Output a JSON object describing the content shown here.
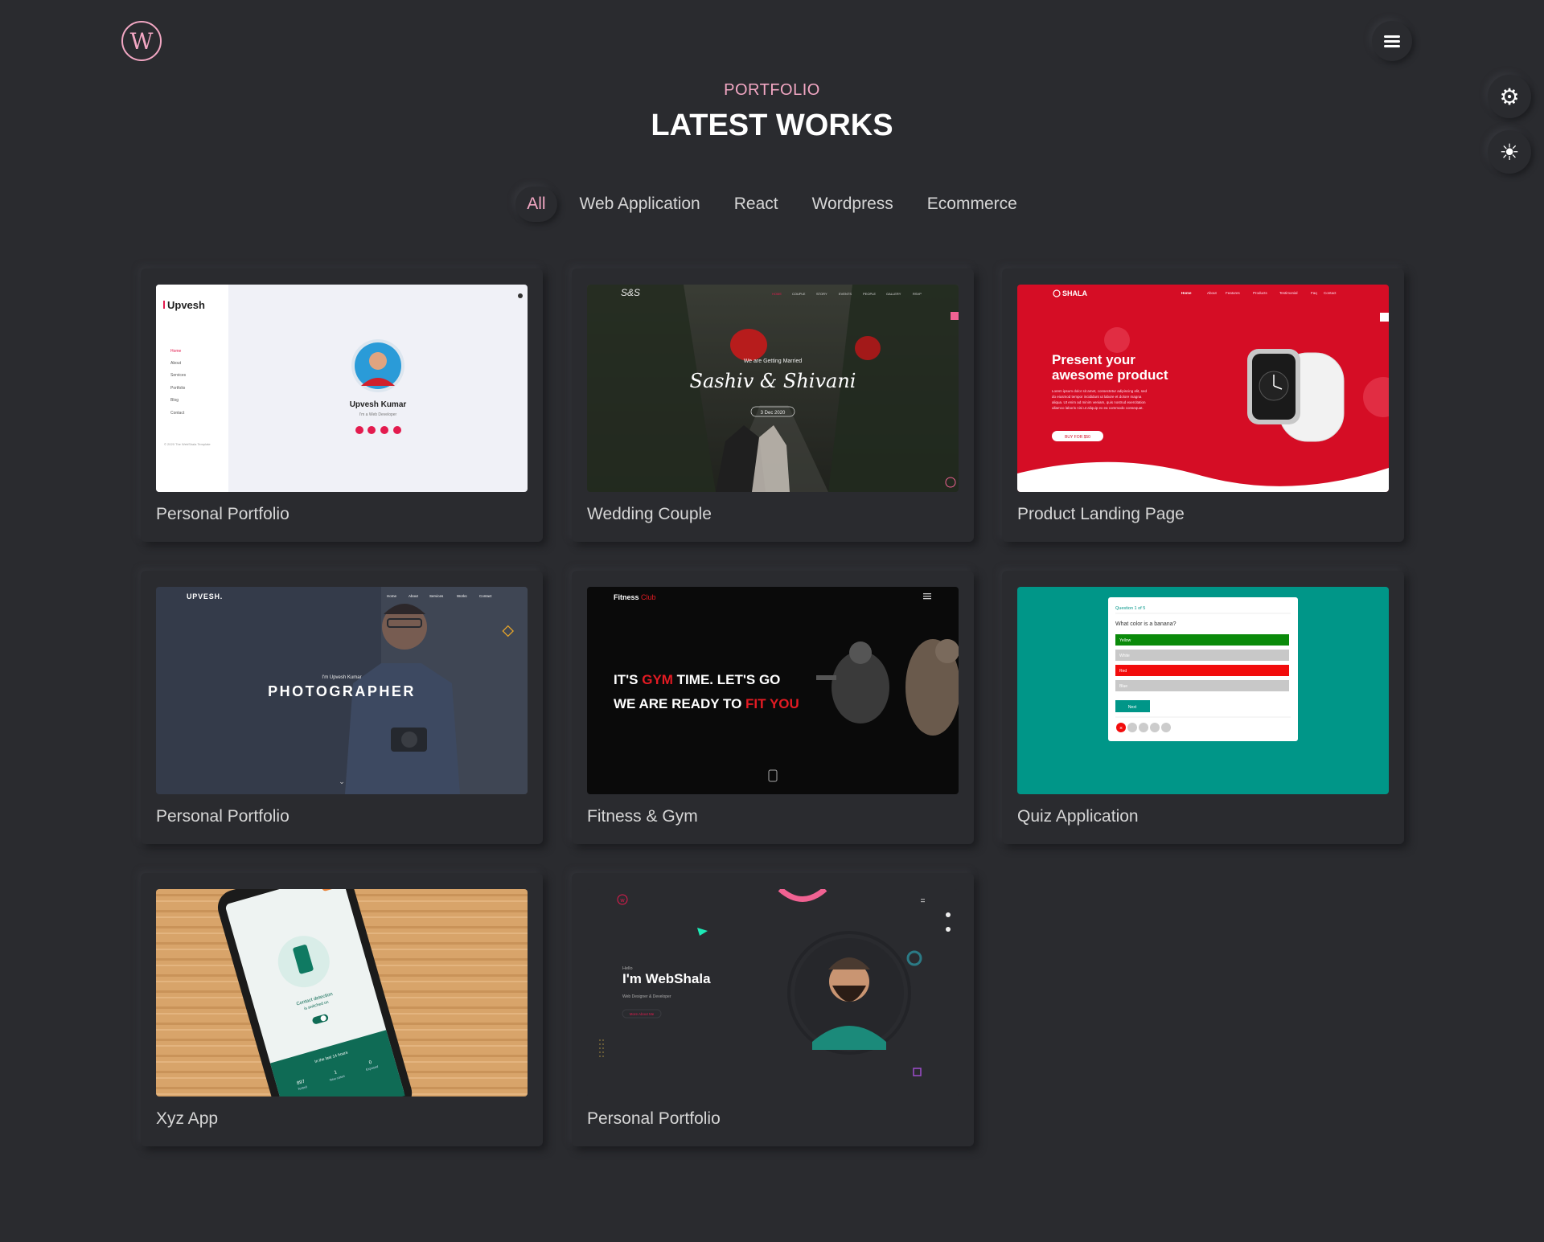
{
  "header": {
    "logo_letter": "W",
    "menu_icon": "hamburger-menu-icon"
  },
  "side_controls": {
    "settings_icon": "gear-icon",
    "theme_icon": "sun-icon"
  },
  "section": {
    "subtitle": "PORTFOLIO",
    "title": "LATEST WORKS"
  },
  "filters": [
    {
      "label": "All",
      "active": true
    },
    {
      "label": "Web Application",
      "active": false
    },
    {
      "label": "React",
      "active": false
    },
    {
      "label": "Wordpress",
      "active": false
    },
    {
      "label": "Ecommerce",
      "active": false
    }
  ],
  "colors": {
    "background": "#2a2b2f",
    "accent": "#f2a7c3",
    "text": "#d6d6d6"
  },
  "works": [
    {
      "caption": "Personal Portfolio",
      "thumb": {
        "brand": "Upvesh",
        "name": "Upvesh Kumar",
        "role": "I'm a Web Developer",
        "nav": [
          "Home",
          "About",
          "Services",
          "Portfolio",
          "Blog",
          "Contact"
        ],
        "footer": "© 2020 The WebShala Template"
      }
    },
    {
      "caption": "Wedding Couple",
      "thumb": {
        "brand": "S&S",
        "nav": [
          "HOME",
          "COUPLE",
          "STORY",
          "EVENTS",
          "PEOPLE",
          "GALLERY",
          "RSVP"
        ],
        "kicker": "We are Getting Married",
        "names": "Sashiv & Shivani",
        "date": "3 Dec 2020"
      }
    },
    {
      "caption": "Product Landing Page",
      "thumb": {
        "brand": "SHALA",
        "nav": [
          "Home",
          "About",
          "Features",
          "Products",
          "Testimonial",
          "Faq",
          "Contact"
        ],
        "headline_1": "Present your",
        "headline_2": "awesome product",
        "body_lines": [
          "Lorem ipsum dolor sit amet, consectetur adipiscing elit, sed",
          "do eiusmod tempor incididunt ut labore et dolore magna",
          "aliqua. Ut enim ad minim veniam, quis nostrud exercitation",
          "ullamco laboris nisi ut aliquip ex ea commodo consequat."
        ],
        "cta": "BUY FOR $50"
      }
    },
    {
      "caption": "Personal Portfolio",
      "thumb": {
        "brand": "UPVESH.",
        "nav": [
          "Home",
          "About",
          "Services",
          "Works",
          "Contact"
        ],
        "kicker": "I'm Upvesh Kumar",
        "headline": "PHOTOGRAPHER"
      }
    },
    {
      "caption": "Fitness & Gym",
      "thumb": {
        "brand_1": "Fitness",
        "brand_2": "Club",
        "line1_a": "IT'S ",
        "line1_b": "GYM",
        "line1_c": " TIME. LET'S GO",
        "line2_a": "WE ARE READY TO ",
        "line2_b": "FIT YOU"
      }
    },
    {
      "caption": "Quiz Application",
      "thumb": {
        "progress": "Question 1 of 5",
        "question": "What color is a banana?",
        "options": [
          "Yellow",
          "White",
          "Red",
          "Blue"
        ],
        "next": "Next"
      }
    },
    {
      "caption": "Xyz App",
      "thumb": {
        "screen_text_1": "Contact detection",
        "screen_text_2": "is switched on",
        "stat_1": "897",
        "stat_1_label": "Tested",
        "stat_2": "1",
        "stat_2_label": "New cases",
        "stat_3": "0",
        "stat_3_label": "Exposed",
        "footer": "In the last 14 hours"
      }
    },
    {
      "caption": "Personal Portfolio",
      "thumb": {
        "kicker": "Hello",
        "headline": "I'm WebShala",
        "role": "Web Designer & Developer",
        "cta": "More About Me"
      }
    }
  ]
}
